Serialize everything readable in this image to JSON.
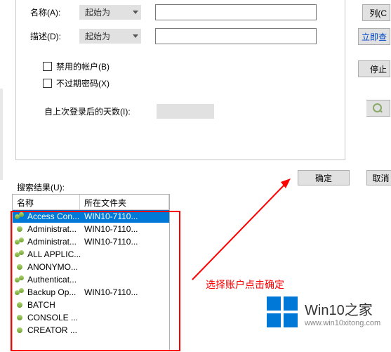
{
  "form": {
    "name_label": "名称(A):",
    "desc_label": "描述(D):",
    "combo_start": "起始为",
    "name_value": "",
    "desc_value": "",
    "chk_disabled": "禁用的帐户(B)",
    "chk_noexpire": "不过期密码(X)",
    "days_label": "自上次登录后的天数(I):",
    "days_value": ""
  },
  "buttons": {
    "columns": "列(C",
    "search_now": "立即查",
    "stop": "停止",
    "ok": "确定",
    "cancel": "取消"
  },
  "results_label": "搜索结果(U):",
  "headers": {
    "name": "名称",
    "loc": "所在文件夹"
  },
  "rows": [
    {
      "name": "Access Con...",
      "loc": "WIN10-7110...",
      "sel": true,
      "ico": "two"
    },
    {
      "name": "Administrat...",
      "loc": "WIN10-7110...",
      "ico": "head"
    },
    {
      "name": "Administrat...",
      "loc": "WIN10-7110...",
      "ico": "two"
    },
    {
      "name": "ALL APPLIC...",
      "loc": "",
      "ico": "two"
    },
    {
      "name": "ANONYMO...",
      "loc": "",
      "ico": "head"
    },
    {
      "name": "Authenticat...",
      "loc": "",
      "ico": "two"
    },
    {
      "name": "Backup Op...",
      "loc": "WIN10-7110...",
      "ico": "two"
    },
    {
      "name": "BATCH",
      "loc": "",
      "ico": "head"
    },
    {
      "name": "CONSOLE ...",
      "loc": "",
      "ico": "head"
    },
    {
      "name": "CREATOR ...",
      "loc": "",
      "ico": "head"
    }
  ],
  "annotation": "选择账户点击确定",
  "watermark": {
    "line1": "Win10之家",
    "line2": "www.win10xitong.com"
  }
}
